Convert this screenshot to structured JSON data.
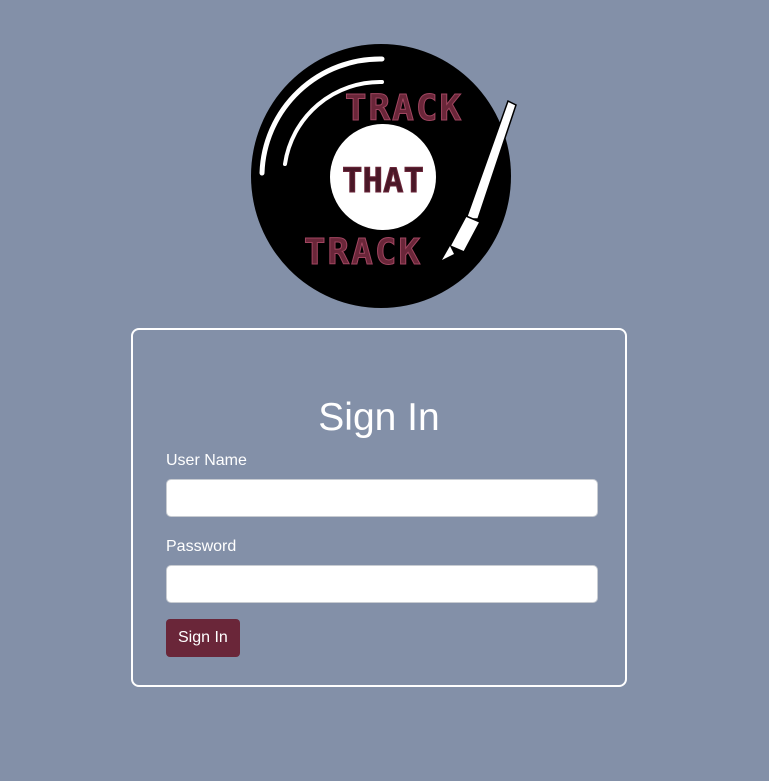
{
  "logo": {
    "word_top": "TRACK",
    "word_middle": "THAT",
    "word_bottom": "TRACK"
  },
  "form": {
    "title": "Sign In",
    "username_label": "User Name",
    "username_value": "",
    "password_label": "Password",
    "password_value": "",
    "submit_label": "Sign In"
  },
  "colors": {
    "background": "#8390a8",
    "brand": "#6a2639",
    "record": "#000000",
    "card_border": "#ffffff"
  }
}
